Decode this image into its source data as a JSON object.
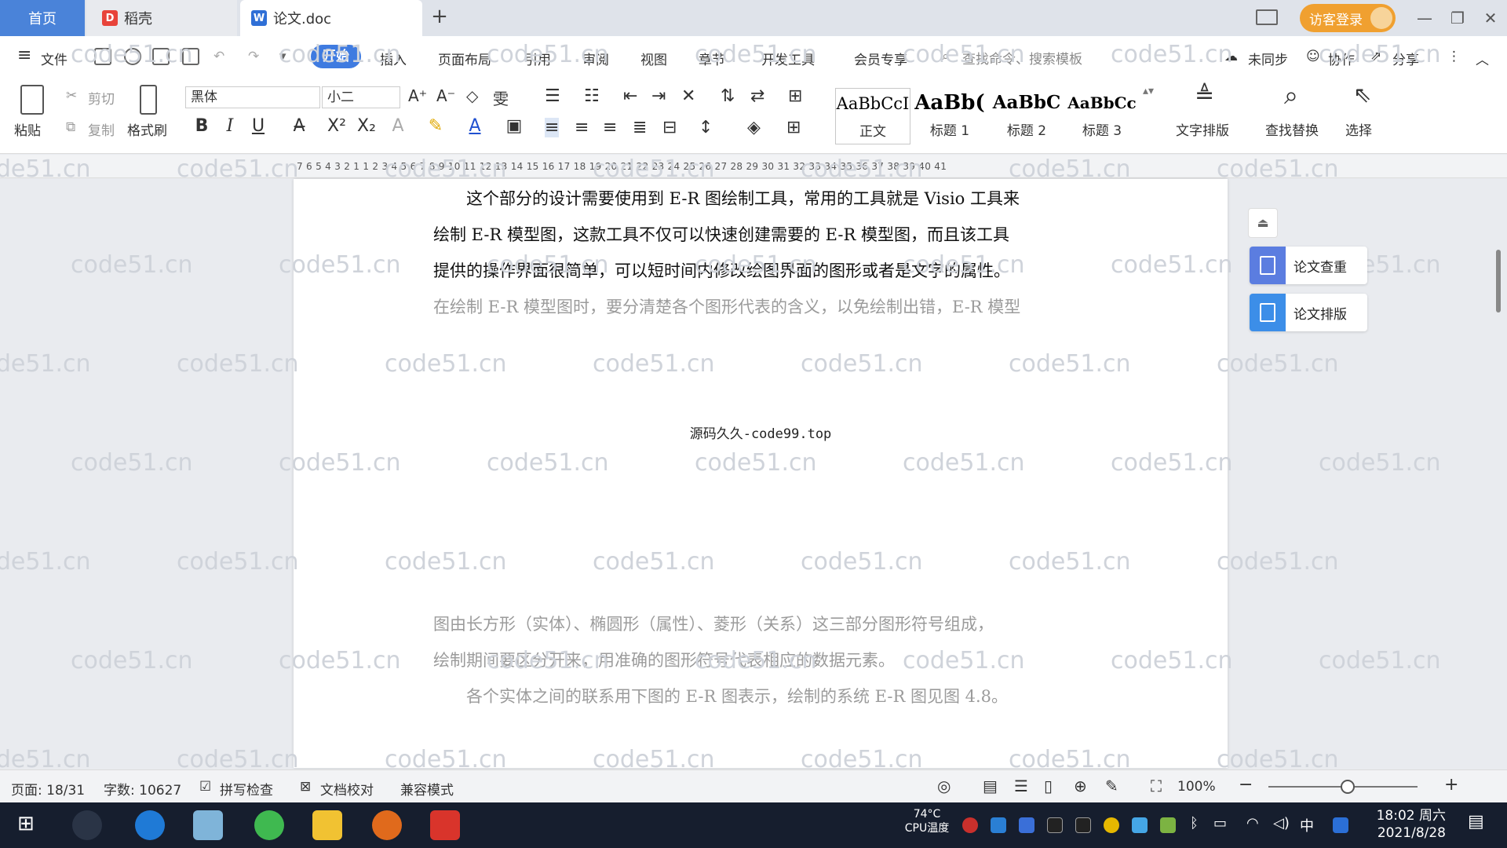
{
  "tabs": {
    "home": "首页",
    "daoke": "稻壳",
    "doc": "论文.doc",
    "new_tab": "+"
  },
  "account": {
    "login": "访客登录"
  },
  "menu": {
    "file": "文件",
    "start": "开始",
    "insert": "插入",
    "layout": "页面布局",
    "reference": "引用",
    "review": "审阅",
    "view": "视图",
    "chapter": "章节",
    "devtools": "开发工具",
    "member": "会员专享",
    "search_placeholder": "查找命令、搜索模板",
    "unsynced": "未同步",
    "collab": "协作",
    "share": "分享"
  },
  "ribbon": {
    "paste": "粘贴",
    "cut": "剪切",
    "copy": "复制",
    "format_painter": "格式刷",
    "font_name": "黑体",
    "font_size": "小二",
    "bold": "B",
    "italic": "I",
    "underline": "U",
    "styles": [
      {
        "sample": "AaBbCcI",
        "name": "正文"
      },
      {
        "sample": "AaBb(",
        "name": "标题 1"
      },
      {
        "sample": "AaBbC",
        "name": "标题 2"
      },
      {
        "sample": "AaBbCc",
        "name": "标题 3"
      }
    ],
    "text_layout": "文字排版",
    "find_replace": "查找替换",
    "select": "选择"
  },
  "ruler": {
    "ticks": "7  6  5  4  3  2  1     1  2  3  4  5  6  7  8  9  10  11  12  13  14  15  16  17  18  19  20  21  22  23  24  25  26  27  28  29  30  31  32  33  34  35  36  37  38  39  40  41"
  },
  "document": {
    "lines_top": [
      "　　这个部分的设计需要使用到 E-R 图绘制工具，常用的工具就是 Visio 工具来",
      "绘制 E-R 模型图，这款工具不仅可以快速创建需要的 E-R 模型图，而且该工具",
      "提供的操作界面很简单，可以短时间内修改绘图界面的图形或者是文字的属性。",
      "在绘制 E-R 模型图时，要分清楚各个图形代表的含义，以免绘制出错，E-R 模型"
    ],
    "caption": "源码久久-code99.top",
    "lines_bottom": [
      "图由长方形（实体）、椭圆形（属性）、菱形（关系）这三部分图形符号组成，",
      "绘制期间要区分开来，用准确的图形符号代表相应的数据元素。",
      "　　各个实体之间的联系用下图的 E-R 图表示，绘制的系统 E-R 图见图 4.8。"
    ],
    "watermark": "code51.cn"
  },
  "side_panel": {
    "check": "论文查重",
    "layout": "论文排版",
    "colors": {
      "check": "#5b7de0",
      "layout": "#3c8ee8"
    }
  },
  "status": {
    "page": "页面: 18/31",
    "words": "字数: 10627",
    "spell": "拼写检查",
    "proof": "文档校对",
    "compat": "兼容模式",
    "zoom": "100%"
  },
  "taskbar": {
    "cpu_temp": "74°C",
    "cpu_label": "CPU温度",
    "ime": "中",
    "time": "18:02 周六",
    "date": "2021/8/28"
  },
  "colors": {
    "accent": "#3f7be0",
    "login": "#f0a030",
    "taskbar": "#161e2e"
  }
}
